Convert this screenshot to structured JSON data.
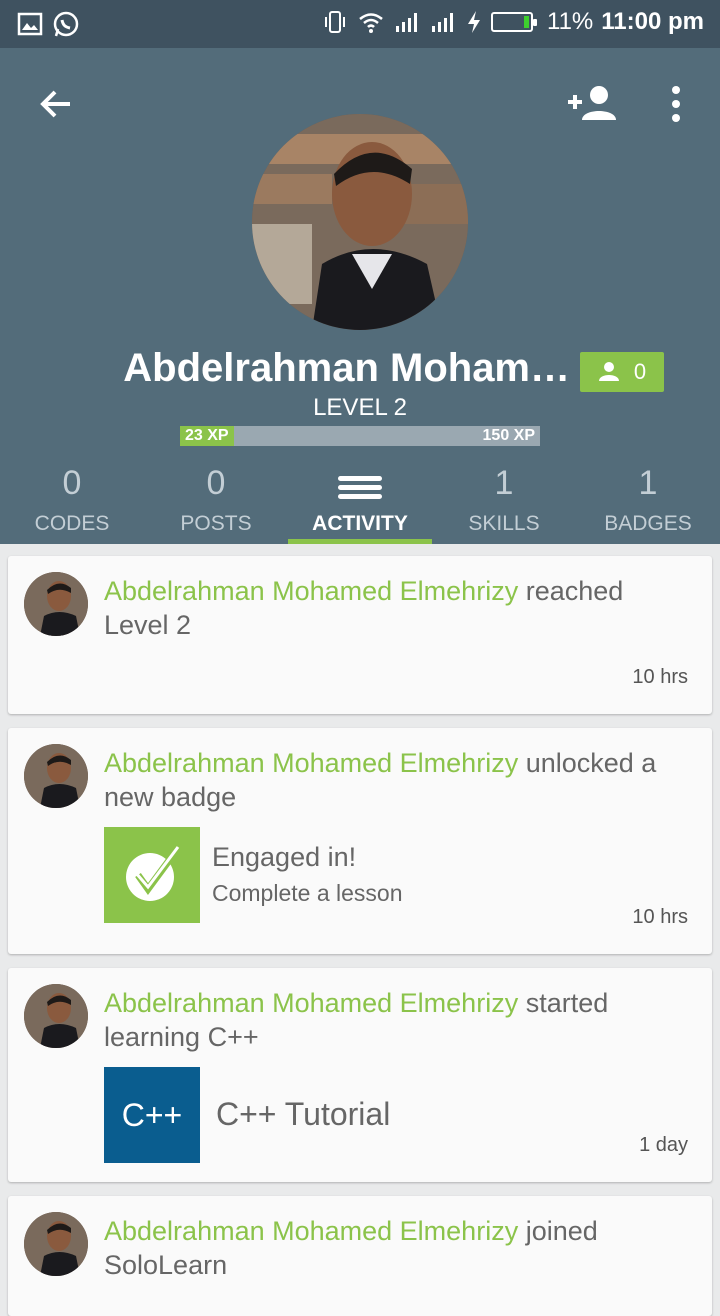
{
  "status_bar": {
    "battery_percent": "11%",
    "time": "11:00 pm",
    "icons": [
      "gallery-icon",
      "whatsapp-icon",
      "vibrate-icon",
      "wifi-icon",
      "signal-icon",
      "signal-icon",
      "charging-icon",
      "battery-icon"
    ]
  },
  "profile": {
    "name": "Abdelrahman Moham…",
    "followers": "0",
    "level": "LEVEL 2",
    "xp_current": "23 XP",
    "xp_target": "150 XP",
    "xp_progress": 0.15
  },
  "tabs": [
    {
      "count": "0",
      "label": "CODES"
    },
    {
      "count": "0",
      "label": "POSTS"
    },
    {
      "icon": "menu-lines-icon",
      "label": "ACTIVITY",
      "active": true
    },
    {
      "count": "1",
      "label": "SKILLS"
    },
    {
      "count": "1",
      "label": "BADGES"
    }
  ],
  "feed": [
    {
      "user": "Abdelrahman Mohamed Elmehrizy",
      "action": " reached Level 2",
      "time": "10 hrs"
    },
    {
      "user": "Abdelrahman Mohamed Elmehrizy",
      "action": " unlocked a new badge",
      "badge_title": "Engaged in!",
      "badge_desc": "Complete a lesson",
      "time": "10 hrs"
    },
    {
      "user": "Abdelrahman Mohamed Elmehrizy",
      "action": " started learning C++",
      "course_icon": "C++",
      "course_title": "C++ Tutorial",
      "time": "1 day"
    },
    {
      "user": "Abdelrahman Mohamed Elmehrizy",
      "action": " joined SoloLearn"
    }
  ],
  "colors": {
    "header": "#536c7a",
    "status": "#3f5260",
    "accent": "#8bc34a",
    "cpp": "#0a5d8f"
  }
}
